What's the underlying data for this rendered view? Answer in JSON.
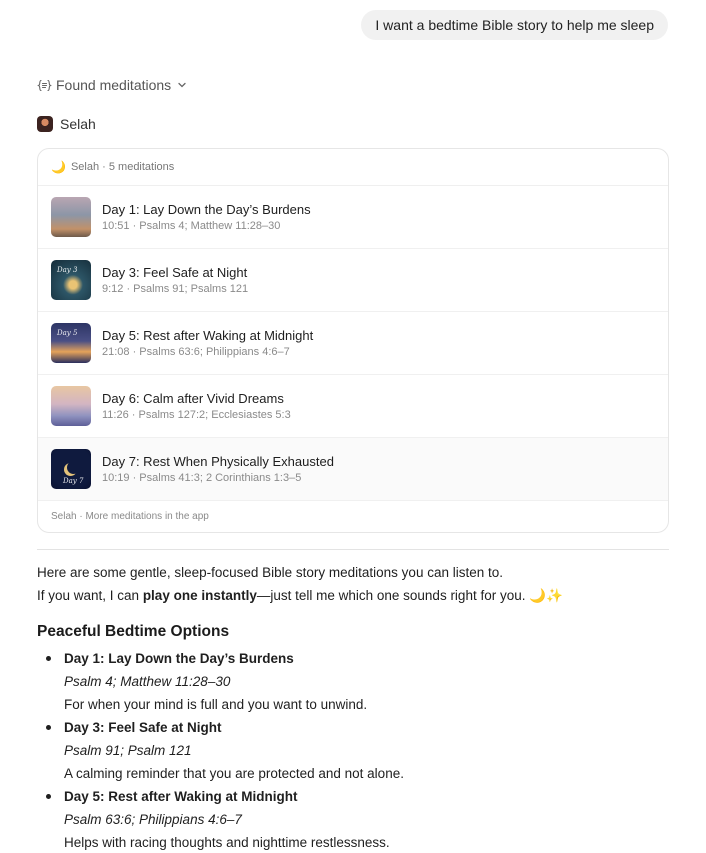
{
  "user_message": "I want a bedtime Bible story to help me sleep",
  "tool_call": {
    "label": "Found meditations",
    "icon": "tool-icon",
    "chevron": "chevron-down-icon"
  },
  "app": {
    "name": "Selah"
  },
  "card": {
    "header_icon": "🌙",
    "header_text": "Selah · 5 meditations",
    "items": [
      {
        "title": "Day 1: Lay Down the Day’s Burdens",
        "meta": "10:51 · Psalms 4; Matthew 11:28–30"
      },
      {
        "title": "Day 3: Feel Safe at Night",
        "meta": "9:12 · Psalms 91; Psalms 121",
        "thumb_label": "Day 3"
      },
      {
        "title": "Day 5: Rest after Waking at Midnight",
        "meta": "21:08 · Psalms 63:6; Philippians 4:6–7",
        "thumb_label": "Day 5"
      },
      {
        "title": "Day 6: Calm after Vivid Dreams",
        "meta": "11:26 · Psalms 127:2; Ecclesiastes 5:3"
      },
      {
        "title": "Day 7: Rest When Physically Exhausted",
        "meta": "10:19 · Psalms 41:3; 2 Corinthians 1:3–5",
        "thumb_label": "Day 7"
      }
    ],
    "footer": "Selah · More meditations in the app"
  },
  "response": {
    "intro": "Here are some gentle, sleep-focused Bible story meditations you can listen to.",
    "offer_prefix": "If you want, I can ",
    "offer_bold": "play one instantly",
    "offer_suffix": "—just tell me which one sounds right for you. 🌙✨",
    "section_title": "Peaceful Bedtime Options",
    "options": [
      {
        "title": "Day 1: Lay Down the Day’s Burdens",
        "ref": "Psalm 4; Matthew 11:28–30",
        "desc": "For when your mind is full and you want to unwind."
      },
      {
        "title": "Day 3: Feel Safe at Night",
        "ref": "Psalm 91; Psalm 121",
        "desc": "A calming reminder that you are protected and not alone."
      },
      {
        "title": "Day 5: Rest after Waking at Midnight",
        "ref": "Psalm 63:6; Philippians 4:6–7",
        "desc": "Helps with racing thoughts and nighttime restlessness."
      }
    ]
  }
}
